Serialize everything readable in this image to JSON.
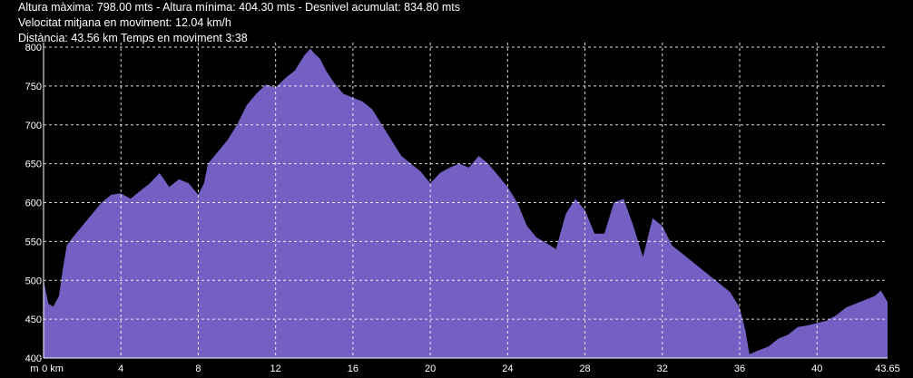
{
  "stats": {
    "line1": "Altura màxima: 798.00 mts - Altura mínima: 404.30 mts - Desnivel acumulat: 834.80 mts",
    "line2": "Velocitat mitjana en moviment: 12.04 km/h",
    "line3": "Distància: 43.56 km Temps en moviment 3:38"
  },
  "chart_data": {
    "type": "area",
    "xlabel": "km",
    "ylabel": "m",
    "xlim": [
      0,
      43.65
    ],
    "ylim": [
      400,
      800
    ],
    "grid": true,
    "x_tick_labels": [
      "0 km",
      "4",
      "8",
      "12",
      "16",
      "20",
      "24",
      "28",
      "32",
      "36",
      "40",
      "43.65"
    ],
    "x_ticks": [
      0,
      4,
      8,
      12,
      16,
      20,
      24,
      28,
      32,
      36,
      40,
      43.65
    ],
    "y_ticks": [
      400,
      450,
      500,
      550,
      600,
      650,
      700,
      750,
      800
    ],
    "colors": {
      "fill": "#7460c2",
      "grid": "#ffffff",
      "background": "#000000",
      "text": "#ffffff"
    },
    "series": [
      {
        "x": [
          0,
          0.25,
          0.5,
          0.8,
          1.0,
          1.2,
          1.5,
          2.0,
          2.5,
          3.0,
          3.5,
          4.0,
          4.5,
          5.0,
          5.5,
          6.0,
          6.5,
          7.0,
          7.5,
          8.0,
          8.3,
          8.5,
          9.0,
          9.5,
          10.0,
          10.5,
          11.0,
          11.5,
          12.0,
          12.5,
          13.0,
          13.5,
          13.8,
          14.0,
          14.3,
          14.6,
          15.0,
          15.5,
          16.0,
          16.5,
          17.0,
          17.5,
          18.0,
          18.5,
          19.0,
          19.5,
          20.0,
          20.5,
          21.0,
          21.5,
          22.0,
          22.5,
          23.0,
          23.5,
          24.0,
          24.5,
          25.0,
          25.5,
          26.0,
          26.5,
          27.0,
          27.5,
          28.0,
          28.5,
          29.0,
          29.5,
          30.0,
          30.5,
          31.0,
          31.5,
          32.0,
          32.5,
          33.0,
          33.5,
          34.0,
          34.5,
          35.0,
          35.5,
          36.0,
          36.3,
          36.5,
          37.0,
          37.5,
          38.0,
          38.5,
          39.0,
          39.5,
          40.0,
          40.5,
          41.0,
          41.5,
          42.0,
          42.5,
          43.0,
          43.3,
          43.65
        ],
        "y": [
          500,
          470,
          466,
          480,
          515,
          545,
          555,
          570,
          585,
          600,
          610,
          612,
          605,
          615,
          625,
          638,
          620,
          630,
          625,
          610,
          625,
          650,
          665,
          680,
          700,
          725,
          740,
          752,
          748,
          760,
          770,
          790,
          798,
          792,
          785,
          770,
          755,
          740,
          735,
          730,
          720,
          700,
          680,
          660,
          650,
          640,
          625,
          638,
          645,
          650,
          645,
          660,
          650,
          635,
          620,
          600,
          570,
          555,
          548,
          540,
          585,
          605,
          590,
          560,
          560,
          600,
          605,
          570,
          530,
          580,
          570,
          545,
          535,
          525,
          515,
          505,
          495,
          485,
          465,
          435,
          405,
          410,
          415,
          425,
          430,
          440,
          442,
          445,
          448,
          455,
          465,
          470,
          475,
          480,
          487,
          472
        ]
      }
    ]
  }
}
